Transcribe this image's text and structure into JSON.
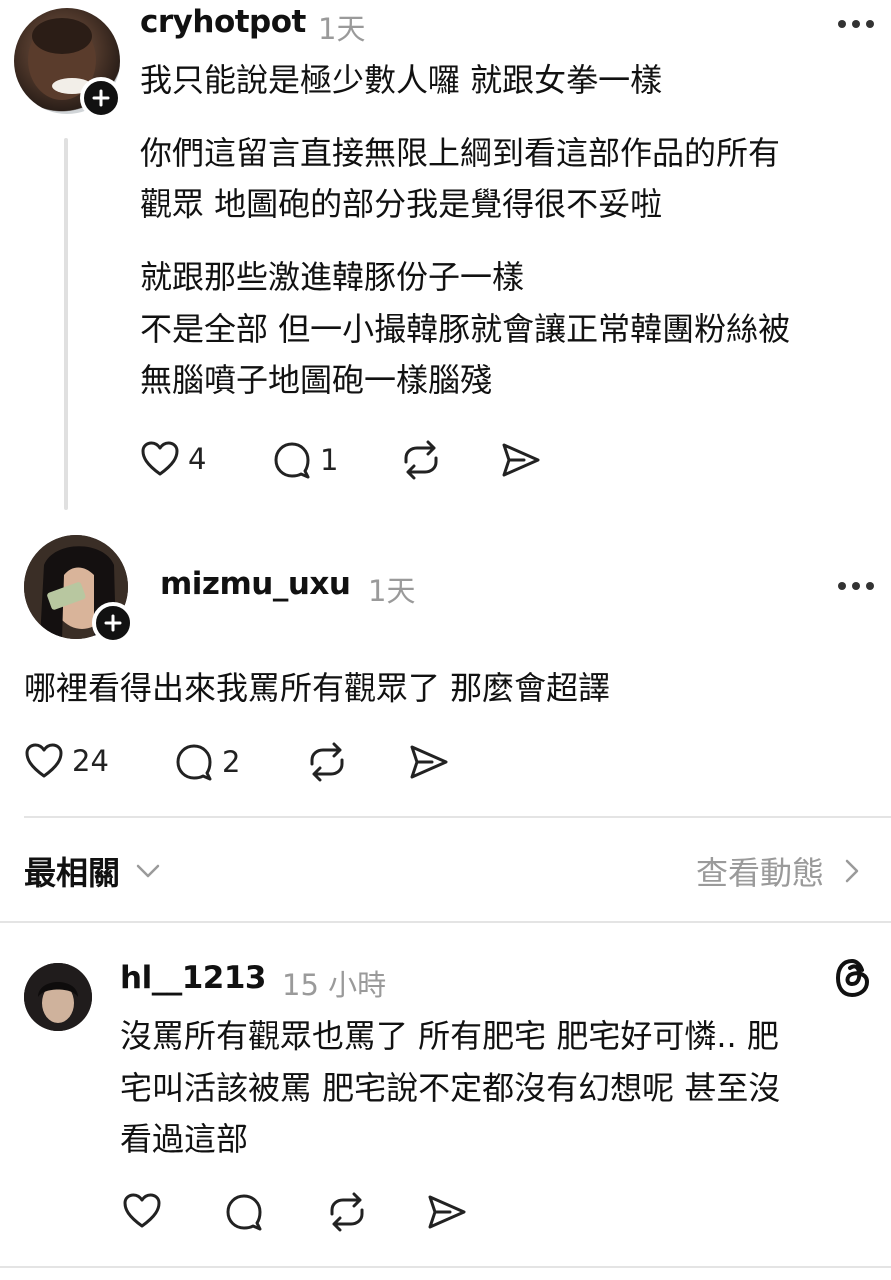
{
  "comments": [
    {
      "username": "cryhotpot",
      "time": "1天",
      "lines": [
        "我只能說是極少數人囉 就跟女拳一樣",
        "你們這留言直接無限上綱到看這部作品的所有",
        "觀眾 地圖砲的部分我是覺得很不妥啦",
        "就跟那些激進韓豚份子一樣",
        "不是全部 但一小撮韓豚就會讓正常韓團粉絲被",
        "無腦噴子地圖砲一樣腦殘"
      ],
      "likes": "4",
      "replies": "1"
    },
    {
      "username": "mizmu_uxu",
      "time": "1天",
      "lines": [
        "哪裡看得出來我罵所有觀眾了 那麼會超譯"
      ],
      "likes": "24",
      "replies": "2"
    },
    {
      "username": "hl__1213",
      "time": "15 小時",
      "lines": [
        "沒罵所有觀眾也罵了 所有肥宅 肥宅好可憐.. 肥",
        "宅叫活該被罵 肥宅說不定都沒有幻想呢 甚至沒",
        "看過這部"
      ]
    }
  ],
  "sort_bar": {
    "label": "最相關",
    "view_activity": "查看動態"
  },
  "icons": {
    "like": "heart-icon",
    "reply": "comment-icon",
    "repost": "repost-icon",
    "share": "send-icon",
    "more": "more-dots-icon",
    "follow": "plus-icon",
    "threads": "threads-logo-icon",
    "chevron_down": "chevron-down-icon",
    "chevron_right": "chevron-right-icon"
  }
}
